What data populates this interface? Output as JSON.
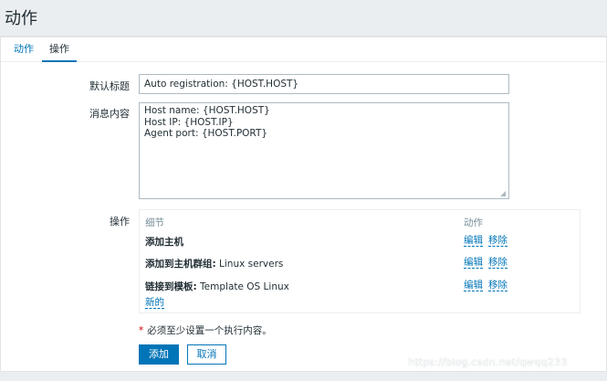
{
  "page": {
    "title": "动作"
  },
  "tabs": [
    {
      "label": "动作"
    },
    {
      "label": "操作"
    }
  ],
  "form": {
    "default_subject_label": "默认标题",
    "default_subject_value": "Auto registration: {HOST.HOST}",
    "default_message_label": "消息内容",
    "default_message_value": "Host name: {HOST.HOST}\nHost IP: {HOST.IP}\nAgent port: {HOST.PORT}",
    "operations_label": "操作"
  },
  "operations": {
    "header_details": "细节",
    "header_action": "动作",
    "rows": [
      {
        "bold": "添加主机",
        "rest": "",
        "edit": "编辑",
        "remove": "移除"
      },
      {
        "bold": "添加到主机群组:",
        "rest": " Linux servers",
        "edit": "编辑",
        "remove": "移除"
      },
      {
        "bold": "链接到模板:",
        "rest": " Template OS Linux",
        "edit": "编辑",
        "remove": "移除"
      }
    ],
    "new_label": "新的"
  },
  "required_note": {
    "star": "*",
    "text": "必须至少设置一个执行内容。"
  },
  "buttons": {
    "add": "添加",
    "cancel": "取消"
  },
  "watermark": "https://blog.csdn.net/qwqq233",
  "colors": {
    "accent": "#0275b8",
    "required": "#d40000",
    "background": "#ebeef0"
  }
}
